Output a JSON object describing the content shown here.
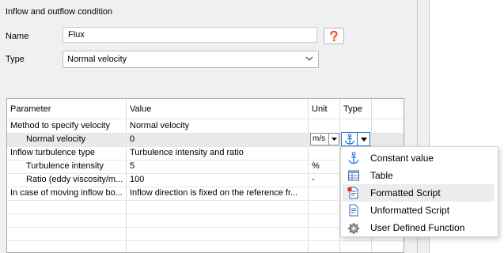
{
  "section_title": "Inflow and outflow condition",
  "name_label": "Name",
  "name_value": "Flux",
  "type_label": "Type",
  "type_value": "Normal velocity",
  "grid": {
    "headers": {
      "parameter": "Parameter",
      "value": "Value",
      "unit": "Unit",
      "type": "Type"
    },
    "rows": [
      {
        "parameter": "Method to specify velocity",
        "value": "Normal velocity",
        "unit": ""
      },
      {
        "parameter": "Normal velocity",
        "value": "0",
        "unit": "m/s"
      },
      {
        "parameter": "Inflow turbulence type",
        "value": "Turbulence intensity and ratio",
        "unit": ""
      },
      {
        "parameter": "Turbulence intensity",
        "value": "5",
        "unit": "%"
      },
      {
        "parameter": "Ratio (eddy viscosity/m...",
        "value": "100",
        "unit": "-"
      },
      {
        "parameter": "In case of moving inflow bo...",
        "value": "Inflow direction is fixed on the reference fr...",
        "unit": ""
      }
    ]
  },
  "type_menu": {
    "items": [
      {
        "label": "Constant value",
        "icon": "anchor-icon"
      },
      {
        "label": "Table",
        "icon": "table-icon"
      },
      {
        "label": "Formatted Script",
        "icon": "formatted-script-icon"
      },
      {
        "label": "Unformatted Script",
        "icon": "unformatted-script-icon"
      },
      {
        "label": "User Defined Function",
        "icon": "function-gear-icon"
      }
    ],
    "highlighted": "Formatted Script"
  },
  "colors": {
    "accent": "#2b6fd6",
    "help_icon": "#e35b1d",
    "panel_bg": "#f0f0f0"
  }
}
